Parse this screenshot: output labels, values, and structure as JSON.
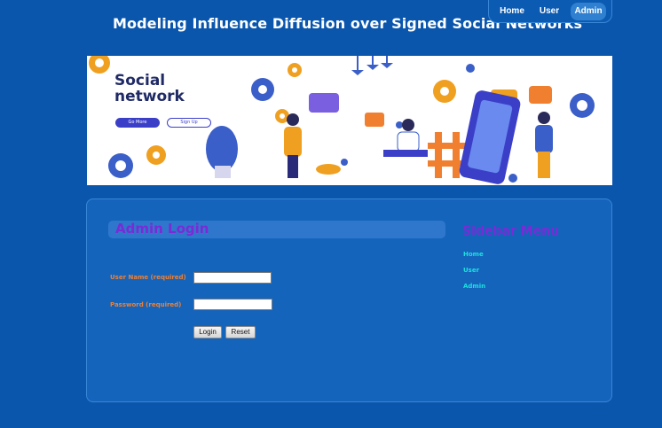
{
  "header": {
    "title": "Modeling Influence Diffusion over Signed Social Networks"
  },
  "nav": {
    "home": "Home",
    "user": "User",
    "admin": "Admin",
    "active": "Admin"
  },
  "banner": {
    "line1": "Social",
    "line2": "network",
    "go_more": "Go More",
    "sign_up": "Sign Up"
  },
  "login": {
    "heading": "Admin Login",
    "username_label": "User Name (required)",
    "password_label": "Password (required)",
    "username_value": "",
    "password_value": "",
    "login_button": "Login",
    "reset_button": "Reset"
  },
  "sidebar": {
    "title": "Sidebar Menu",
    "items": [
      "Home",
      "User",
      "Admin"
    ]
  },
  "colors": {
    "background": "#0a56ad",
    "panel": "#1464bc",
    "heading_purple": "#7a2bd6",
    "label_orange": "#f08030",
    "link_cyan": "#1ee0e0"
  }
}
